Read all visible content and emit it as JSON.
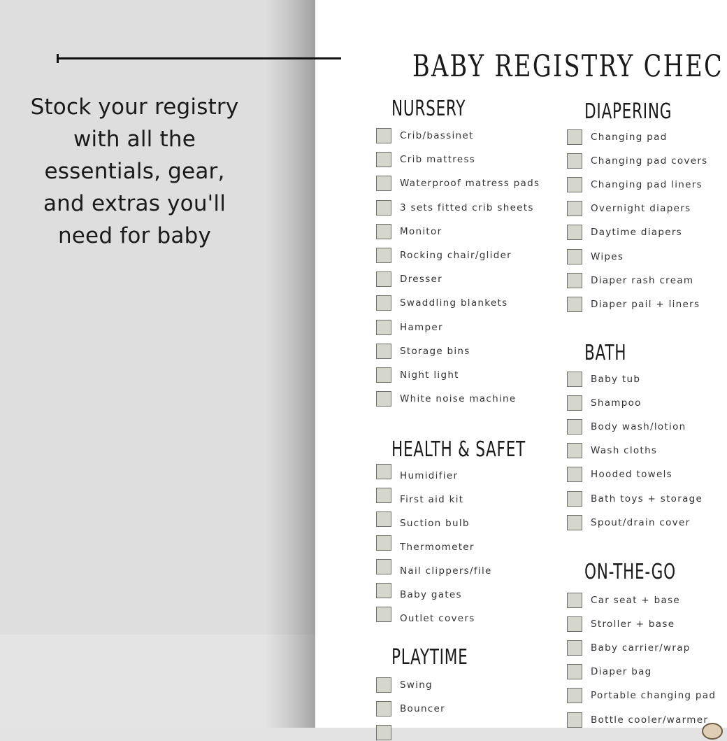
{
  "sidebar": {
    "tagline": "Stock your registry with all the essentials, gear, and extras you'll need for baby"
  },
  "document": {
    "title": "BABY REGISTRY CHEC",
    "sections": [
      {
        "heading": "NURSERY",
        "items": [
          "Crib/bassinet",
          "Crib mattress",
          "Waterproof matress pads",
          "3 sets fitted crib sheets",
          "Monitor",
          "Rocking chair/glider",
          "Dresser",
          "Swaddling blankets",
          "Hamper",
          "Storage bins",
          "Night light",
          "White noise machine"
        ]
      },
      {
        "heading": "HEALTH & SAFET",
        "items": [
          "Humidifier",
          "First aid kit",
          "Suction bulb",
          "Thermometer",
          "Nail clippers/file",
          "Baby gates",
          "Outlet covers"
        ]
      },
      {
        "heading": "PLAYTIME",
        "items": [
          "Swing",
          "Bouncer",
          ""
        ]
      },
      {
        "heading": "DIAPERING",
        "items": [
          "Changing pad",
          "Changing pad covers",
          "Changing pad liners",
          "Overnight diapers",
          "Daytime diapers",
          "Wipes",
          "Diaper rash cream",
          "Diaper pail + liners"
        ]
      },
      {
        "heading": "BATH",
        "items": [
          "Baby tub",
          "Shampoo",
          "Body wash/lotion",
          "Wash cloths",
          "Hooded towels",
          "Bath toys + storage",
          "Spout/drain cover"
        ]
      },
      {
        "heading": "ON-THE-GO",
        "items": [
          "Car seat + base",
          "Stroller + base",
          "Baby carrier/wrap",
          "Diaper bag",
          "Portable changing pad",
          "Bottle cooler/warmer"
        ]
      }
    ]
  },
  "colors": {
    "checkbox_fill": "#d5d6cc",
    "checkbox_border": "#6f6f68",
    "background": "#e3e3e3",
    "paper": "#ffffff",
    "text": "#1a1a1a"
  }
}
